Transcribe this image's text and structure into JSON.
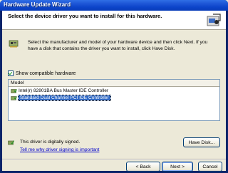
{
  "window": {
    "title": "Hardware Update Wizard"
  },
  "header": {
    "title": "Select the device driver you want to install for this hardware."
  },
  "intro": {
    "text": "Select the manufacturer and model of your hardware device and then click Next. If you have a disk that contains the driver you want to install, click Have Disk."
  },
  "compatible": {
    "label": "Show compatible hardware",
    "checked": true
  },
  "model_list": {
    "header": "Model",
    "items": [
      {
        "label": "Intel(r) 82801BA Bus Master IDE Controller",
        "selected": false
      },
      {
        "label": "Standard Dual Channel PCI IDE Controller",
        "selected": true
      }
    ]
  },
  "signature": {
    "status": "This driver is digitally signed.",
    "link": "Tell me why driver signing is important"
  },
  "buttons": {
    "have_disk": "Have Disk...",
    "back": "< Back",
    "next": "Next >",
    "cancel": "Cancel"
  },
  "colors": {
    "title_bar": "#0b43c8",
    "selection": "#316ac5",
    "link": "#0000cc",
    "face": "#ece9d8"
  },
  "icons": [
    "wizard-hardware-icon",
    "hardware-card-icon",
    "driver-icon",
    "signed-driver-icon"
  ]
}
